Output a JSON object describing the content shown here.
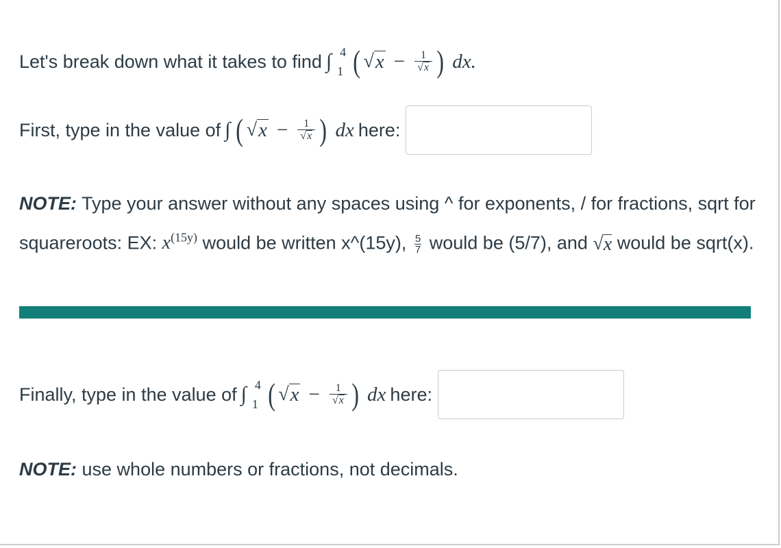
{
  "intro": {
    "text": "Let's break down what it takes to find",
    "integral_lower": "1",
    "integral_upper": "4",
    "sqrt_arg": "x",
    "frac_num": "1",
    "dx": "dx."
  },
  "step1": {
    "prefix": "First, type in the value of",
    "sqrt_arg": "x",
    "frac_num": "1",
    "dx": "dx",
    "suffix": "here:",
    "input_value": ""
  },
  "note1": {
    "label": "NOTE:",
    "text1": "Type your answer without any spaces using ^ for exponents, / for fractions, sqrt for squareroots: EX:",
    "x": "x",
    "exp": "(15y)",
    "text2": "would be written x^(15y),",
    "frac_num": "5",
    "frac_den": "7",
    "text3": "would be (5/7), and",
    "sqrt_arg": "x",
    "text4": "would be sqrt(x)."
  },
  "step2": {
    "prefix": "Finally, type in the value of",
    "integral_lower": "1",
    "integral_upper": "4",
    "sqrt_arg": "x",
    "frac_num": "1",
    "dx": "dx",
    "suffix": "here:",
    "input_value": ""
  },
  "note2": {
    "label": "NOTE:",
    "text": "use whole numbers or fractions, not decimals."
  },
  "colors": {
    "divider": "#127f7a",
    "text": "#2d3b45",
    "input_border": "#c7cdd1"
  }
}
